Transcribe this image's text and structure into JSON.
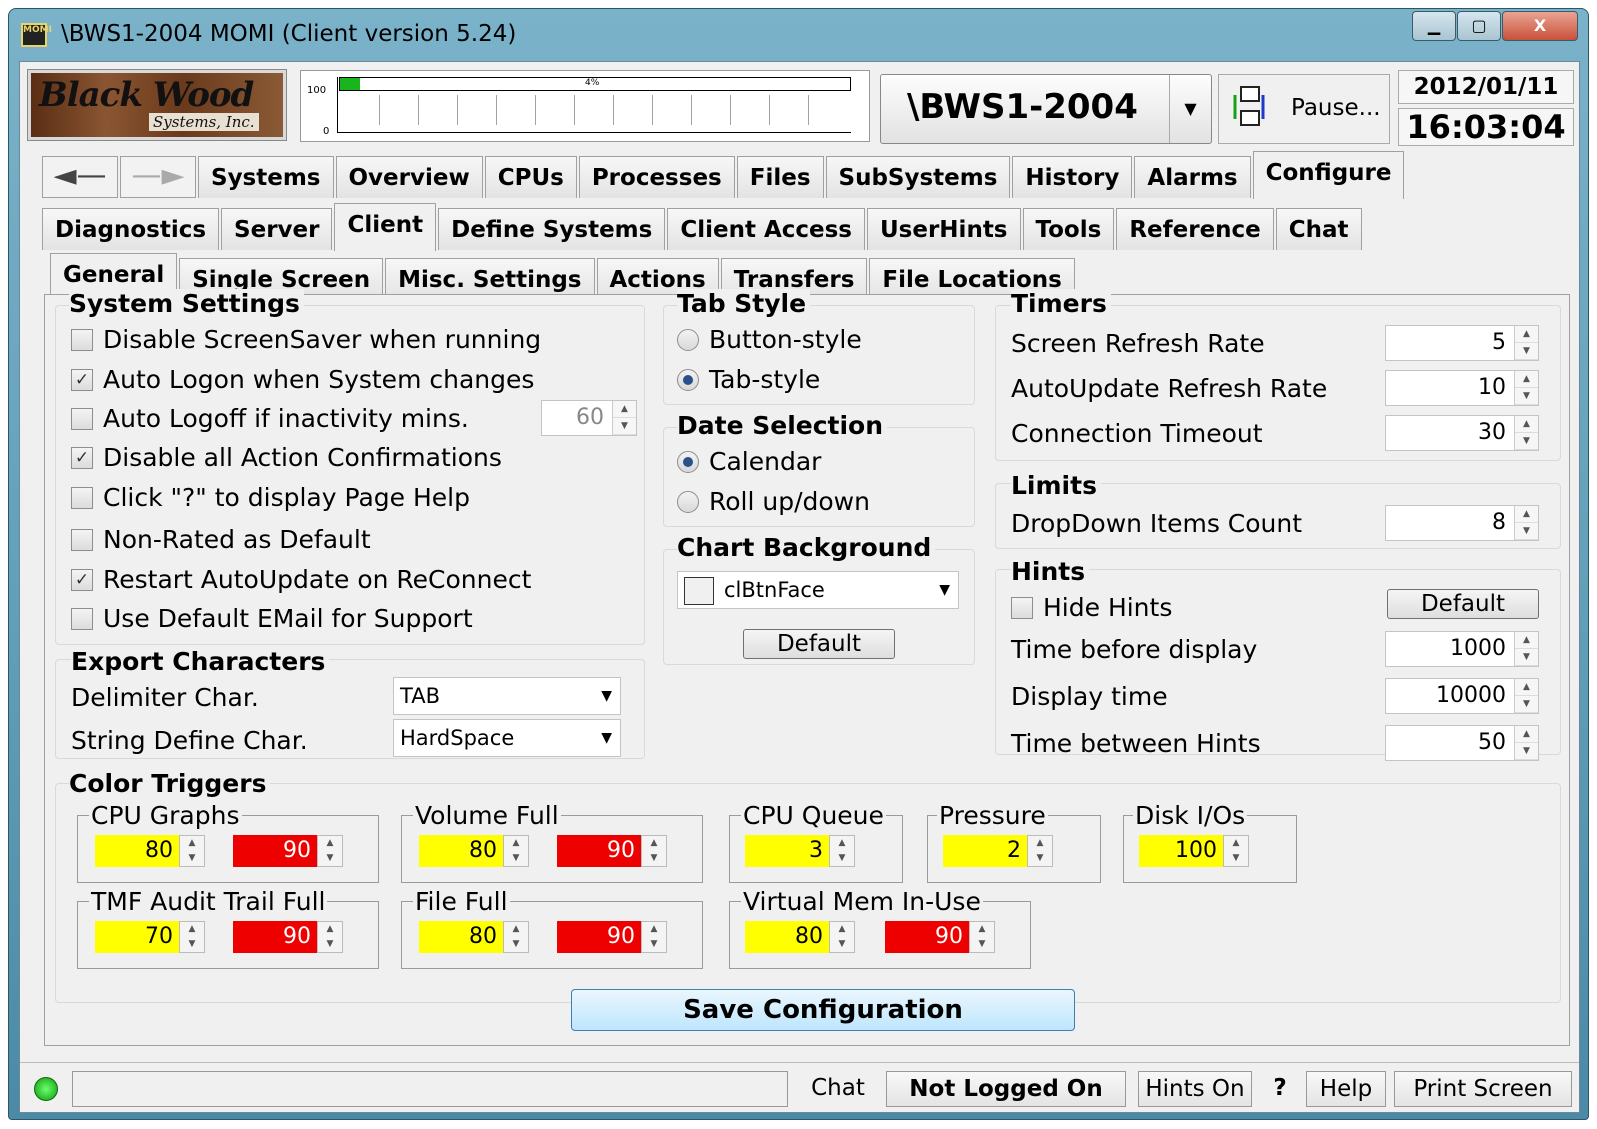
{
  "window": {
    "title": "\\BWS1-2004 MOMI (Client version 5.24)",
    "app_icon": "MOMI",
    "minimize": "▁",
    "maximize": "▢",
    "close": "X"
  },
  "logo": {
    "line1": "Black Wood",
    "line2": "Systems, Inc."
  },
  "graph": {
    "y_max": "100",
    "y_min": "0",
    "percent": "4%",
    "fill_fraction": 0.04
  },
  "system": {
    "name": "\\BWS1-2004"
  },
  "pause": {
    "label": "Pause..."
  },
  "clock": {
    "date": "2012/01/11",
    "time": "16:03:04"
  },
  "tabs_main": [
    "Systems",
    "Overview",
    "CPUs",
    "Processes",
    "Files",
    "SubSystems",
    "History",
    "Alarms",
    "Configure"
  ],
  "tabs_config": [
    "Diagnostics",
    "Server",
    "Client",
    "Define Systems",
    "Client Access",
    "UserHints",
    "Tools",
    "Reference",
    "Chat"
  ],
  "tabs_client": [
    "General",
    "Single Screen",
    "Misc. Settings",
    "Actions",
    "Transfers",
    "File Locations"
  ],
  "system_settings": {
    "title": "System Settings",
    "items": [
      {
        "label": "Disable ScreenSaver when running",
        "checked": ""
      },
      {
        "label": "Auto Logon when System changes",
        "checked": "✓"
      },
      {
        "label": "Auto Logoff if inactivity mins.",
        "checked": ""
      },
      {
        "label": "Disable all Action Confirmations",
        "checked": "✓"
      },
      {
        "label": "Click \"?\" to display Page Help",
        "checked": ""
      },
      {
        "label": "Non-Rated as Default",
        "checked": ""
      },
      {
        "label": "Restart AutoUpdate on ReConnect",
        "checked": "✓"
      },
      {
        "label": "Use Default EMail for Support",
        "checked": ""
      }
    ],
    "logoff_mins": "60"
  },
  "tab_style": {
    "title": "Tab Style",
    "options": [
      "Button-style",
      "Tab-style"
    ],
    "selected": "Tab-style"
  },
  "date_selection": {
    "title": "Date Selection",
    "options": [
      "Calendar",
      "Roll up/down"
    ],
    "selected": "Calendar"
  },
  "chart_background": {
    "title": "Chart Background",
    "value": "clBtnFace",
    "default_label": "Default"
  },
  "export_chars": {
    "title": "Export Characters",
    "delimiter_label": "Delimiter Char.",
    "delimiter_value": "TAB",
    "string_label": "String Define Char.",
    "string_value": "HardSpace"
  },
  "timers": {
    "title": "Timers",
    "items": [
      {
        "label": "Screen Refresh Rate",
        "value": "5"
      },
      {
        "label": "AutoUpdate Refresh Rate",
        "value": "10"
      },
      {
        "label": "Connection Timeout",
        "value": "30"
      }
    ]
  },
  "limits": {
    "title": "Limits",
    "label": "DropDown Items Count",
    "value": "8"
  },
  "hints": {
    "title": "Hints",
    "hide_label": "Hide Hints",
    "default_label": "Default",
    "items": [
      {
        "label": "Time before display",
        "value": "1000"
      },
      {
        "label": "Display time",
        "value": "10000"
      },
      {
        "label": "Time between Hints",
        "value": "50"
      }
    ]
  },
  "color_triggers": {
    "title": "Color Triggers",
    "groups": [
      {
        "name": "CPU Graphs",
        "warn": "80",
        "crit": "90"
      },
      {
        "name": "Volume Full",
        "warn": "80",
        "crit": "90"
      },
      {
        "name": "CPU Queue",
        "warn": "3"
      },
      {
        "name": "Pressure",
        "warn": "2"
      },
      {
        "name": "Disk I/Os",
        "warn": "100"
      },
      {
        "name": "TMF Audit Trail Full",
        "warn": "70",
        "crit": "90"
      },
      {
        "name": "File Full",
        "warn": "80",
        "crit": "90"
      },
      {
        "name": "Virtual Mem In-Use",
        "warn": "80",
        "crit": "90"
      }
    ],
    "warn_color": "#ffff00",
    "crit_color": "#ee0000"
  },
  "save_label": "Save Configuration",
  "status": {
    "chat": "Chat",
    "login": "Not Logged On",
    "hints": "Hints On",
    "question": "?",
    "help": "Help",
    "print": "Print Screen"
  }
}
